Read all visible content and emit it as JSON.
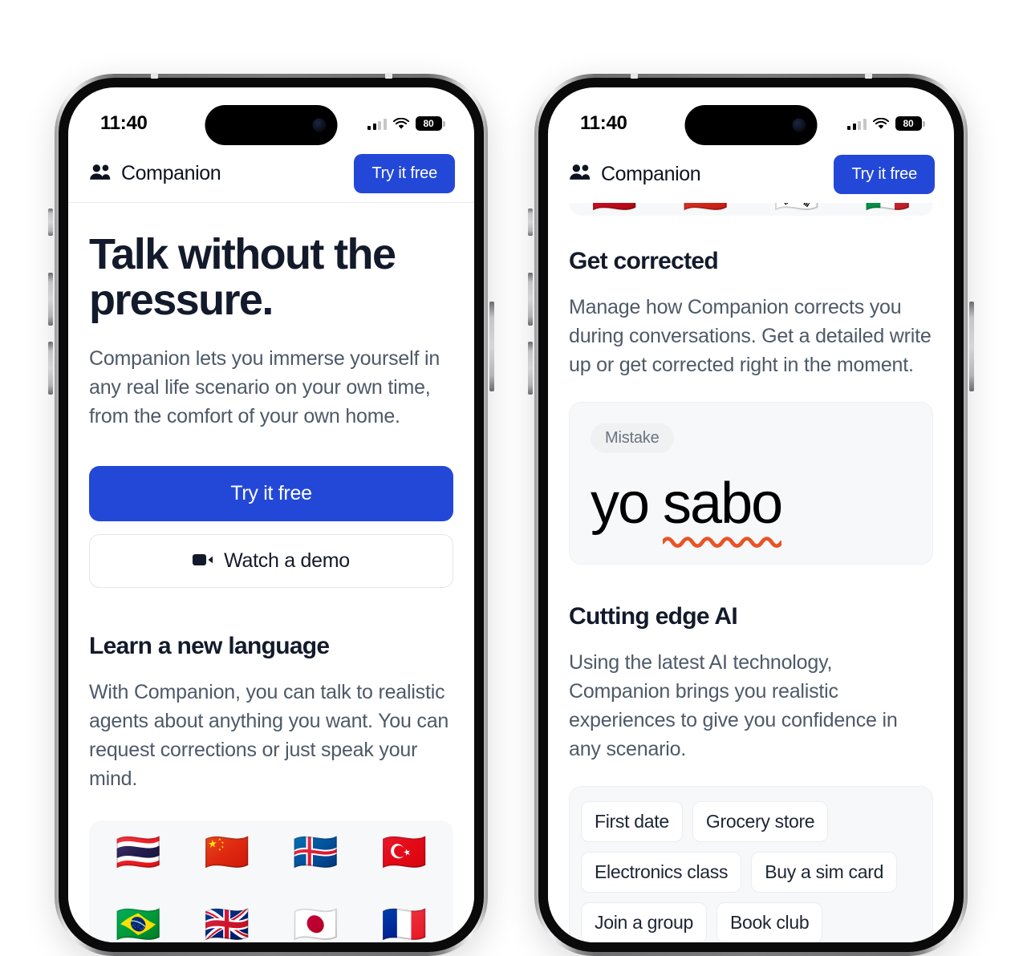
{
  "status_bar": {
    "time": "11:40",
    "battery_level": "80",
    "cellular_icon": "cellular-bars-icon",
    "wifi_icon": "wifi-icon",
    "battery_icon": "battery-icon"
  },
  "app_header": {
    "brand_icon": "users-icon",
    "brand_name": "Companion",
    "cta_label": "Try it free"
  },
  "phone_left": {
    "hero_title": "Talk without the pressure.",
    "hero_subtitle": "Companion lets you immerse yourself in any real life scenario on your own time, from the comfort of your own home.",
    "primary_cta": "Try it free",
    "secondary_cta": "Watch a demo",
    "secondary_cta_icon": "video-camera-icon",
    "section_title": "Learn a new language",
    "section_body": "With Companion, you can talk to realistic agents about anything you want. You can request corrections or just speak your mind.",
    "flags": [
      {
        "name": "flag-thailand",
        "glyph": "🇹🇭"
      },
      {
        "name": "flag-china",
        "glyph": "🇨🇳"
      },
      {
        "name": "flag-iceland",
        "glyph": "🇮🇸"
      },
      {
        "name": "flag-turkey",
        "glyph": "🇹🇷"
      },
      {
        "name": "flag-brazil",
        "glyph": "🇧🇷"
      },
      {
        "name": "flag-united-kingdom",
        "glyph": "🇬🇧"
      },
      {
        "name": "flag-japan",
        "glyph": "🇯🇵"
      },
      {
        "name": "flag-france",
        "glyph": "🇫🇷"
      }
    ]
  },
  "phone_right": {
    "partial_flags": [
      {
        "name": "flag-spain",
        "glyph": "🇪🇸"
      },
      {
        "name": "flag-russia",
        "glyph": "🇷🇺"
      },
      {
        "name": "flag-south-korea",
        "glyph": "🇰🇷"
      },
      {
        "name": "flag-italy",
        "glyph": "🇮🇹"
      }
    ],
    "section_one_title": "Get corrected",
    "section_one_body": "Manage how Companion corrects you during conversations. Get a detailed write up or get corrected right in the moment.",
    "mistake_badge": "Mistake",
    "mistake_correct_part": "yo ",
    "mistake_wrong_part": "sabo",
    "section_two_title": "Cutting edge AI",
    "section_two_body": "Using the latest AI technology, Companion brings you realistic experiences to give you confidence in any scenario.",
    "scenario_chips": [
      "First date",
      "Grocery store",
      "Electronics class",
      "Buy a sim card",
      "Join a group",
      "Book club"
    ]
  },
  "colors": {
    "accent_blue": "#2348d8",
    "error_orange": "#ea5226",
    "text_dark": "#131a2b",
    "text_muted": "#4e5968",
    "card_bg": "#f7f8f9"
  }
}
